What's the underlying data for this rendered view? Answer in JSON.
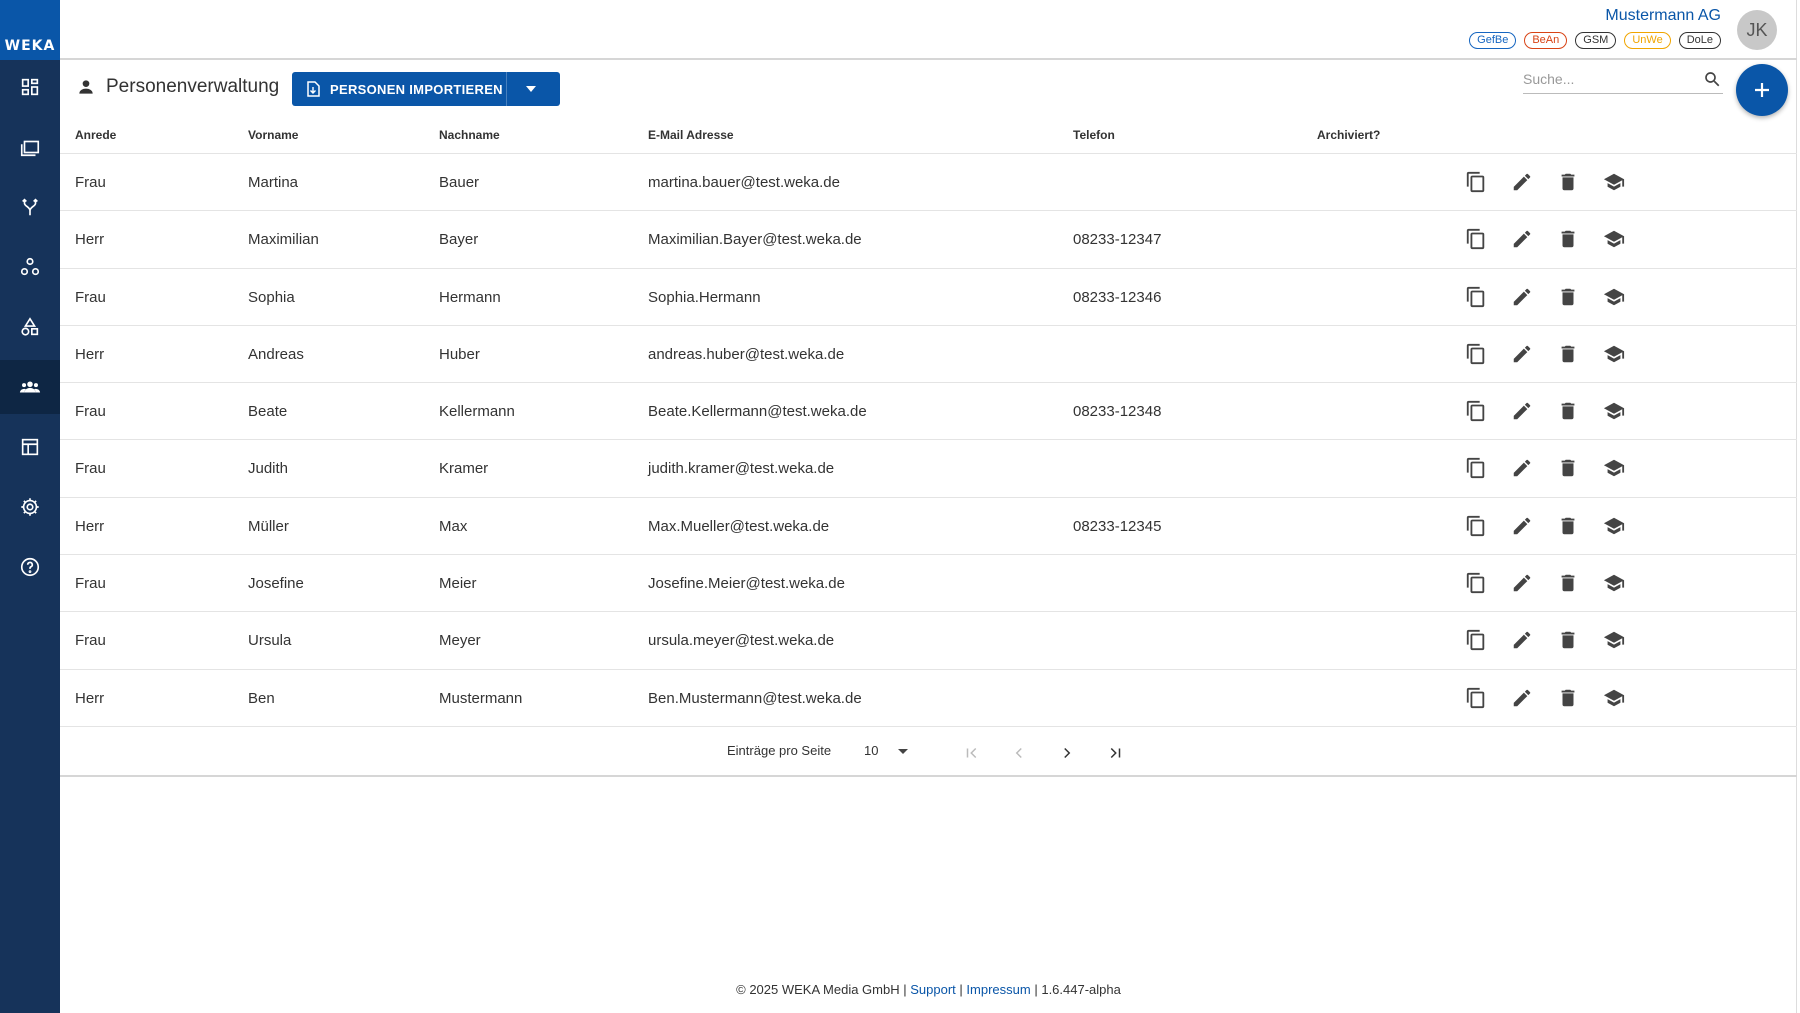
{
  "brand": {
    "logo_text": "WEKA"
  },
  "header": {
    "company": "Mustermann AG",
    "avatar_initials": "JK",
    "badges": [
      {
        "label": "GefBe",
        "color": "#1565c0"
      },
      {
        "label": "BeAn",
        "color": "#d84315"
      },
      {
        "label": "GSM",
        "color": "#333333"
      },
      {
        "label": "UnWe",
        "color": "#f0a500"
      },
      {
        "label": "DoLe",
        "color": "#333333"
      }
    ]
  },
  "page": {
    "title": "Personenverwaltung",
    "import_button": "PERSONEN IMPORTIEREN",
    "search_placeholder": "Suche..."
  },
  "table": {
    "columns": [
      "Anrede",
      "Vorname",
      "Nachname",
      "E-Mail Adresse",
      "Telefon",
      "Archiviert?"
    ],
    "rows": [
      [
        "Frau",
        "Martina",
        "Bauer",
        "martina.bauer@test.weka.de",
        "",
        ""
      ],
      [
        "Herr",
        "Maximilian",
        "Bayer",
        "Maximilian.Bayer@test.weka.de",
        "08233-12347",
        ""
      ],
      [
        "Frau",
        "Sophia",
        "Hermann",
        "Sophia.Hermann",
        "08233-12346",
        ""
      ],
      [
        "Herr",
        "Andreas",
        "Huber",
        "andreas.huber@test.weka.de",
        "",
        ""
      ],
      [
        "Frau",
        "Beate",
        "Kellermann",
        "Beate.Kellermann@test.weka.de",
        "08233-12348",
        ""
      ],
      [
        "Frau",
        "Judith",
        "Kramer",
        "judith.kramer@test.weka.de",
        "",
        ""
      ],
      [
        "Herr",
        "Müller",
        "Max",
        "Max.Mueller@test.weka.de",
        "08233-12345",
        ""
      ],
      [
        "Frau",
        "Josefine",
        "Meier",
        "Josefine.Meier@test.weka.de",
        "",
        ""
      ],
      [
        "Frau",
        "Ursula",
        "Meyer",
        "ursula.meyer@test.weka.de",
        "",
        ""
      ],
      [
        "Herr",
        "Ben",
        "Mustermann",
        "Ben.Mustermann@test.weka.de",
        "",
        ""
      ]
    ],
    "row_actions": [
      "copy-icon",
      "edit-icon",
      "delete-icon",
      "training-icon"
    ]
  },
  "pagination": {
    "label": "Einträge pro Seite",
    "page_size": "10"
  },
  "footer": {
    "copyright": "© 2025 WEKA Media GmbH |",
    "support": "Support",
    "sep": "|",
    "impressum": "Impressum",
    "version": "| 1.6.447-alpha"
  },
  "sidebar": {
    "icons": [
      "dashboard-icon",
      "folders-icon",
      "branch-icon",
      "hierarchy-icon",
      "shapes-icon",
      "people-icon",
      "table-icon",
      "settings-icon",
      "help-icon"
    ]
  }
}
